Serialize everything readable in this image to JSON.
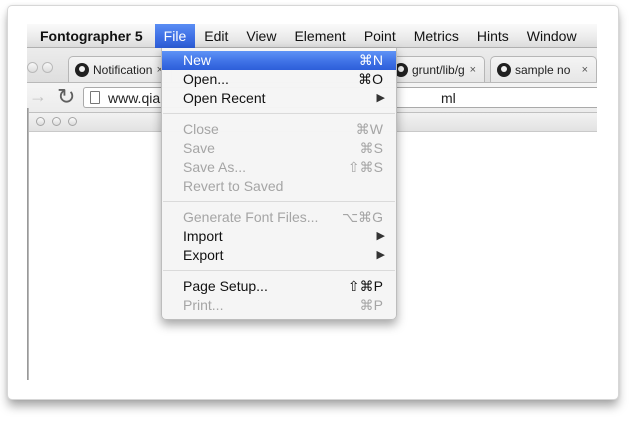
{
  "menu_bar": {
    "items": [
      {
        "label": "Fontographer 5"
      },
      {
        "label": "File"
      },
      {
        "label": "Edit"
      },
      {
        "label": "View"
      },
      {
        "label": "Element"
      },
      {
        "label": "Point"
      },
      {
        "label": "Metrics"
      },
      {
        "label": "Hints"
      },
      {
        "label": "Window"
      }
    ]
  },
  "browser": {
    "tabs": [
      {
        "title": "Notification",
        "close": "×",
        "icon": "github-icon"
      },
      {
        "title": "grunt/lib/g",
        "close": "×",
        "icon": "github-icon"
      },
      {
        "title": "sample no",
        "close": "×",
        "icon": "github-icon"
      }
    ],
    "address": {
      "forward_icon": "→",
      "reload_icon": "↻",
      "url_visible": "www.qia",
      "url_tail": "ml"
    }
  },
  "file_menu": {
    "items": [
      {
        "label": "New",
        "shortcut": "⌘N",
        "state": "highlighted"
      },
      {
        "label": "Open...",
        "shortcut": "⌘O",
        "state": "enabled"
      },
      {
        "label": "Open Recent",
        "arrow": "▶",
        "state": "enabled"
      },
      {
        "label": "Close",
        "shortcut": "⌘W",
        "state": "disabled"
      },
      {
        "label": "Save",
        "shortcut": "⌘S",
        "state": "disabled"
      },
      {
        "label": "Save As...",
        "shortcut": "⇧⌘S",
        "state": "disabled"
      },
      {
        "label": "Revert to Saved",
        "state": "disabled"
      },
      {
        "label": "Generate Font Files...",
        "shortcut": "⌥⌘G",
        "state": "disabled"
      },
      {
        "label": "Import",
        "arrow": "▶",
        "state": "enabled"
      },
      {
        "label": "Export",
        "arrow": "▶",
        "state": "enabled"
      },
      {
        "label": "Page Setup...",
        "shortcut": "⇧⌘P",
        "state": "enabled"
      },
      {
        "label": "Print...",
        "shortcut": "⌘P",
        "state": "disabled"
      }
    ]
  },
  "colors": {
    "menu_highlight": "#3f72e6",
    "disabled_text": "#a5a5a5",
    "menu_text": "#111111"
  }
}
